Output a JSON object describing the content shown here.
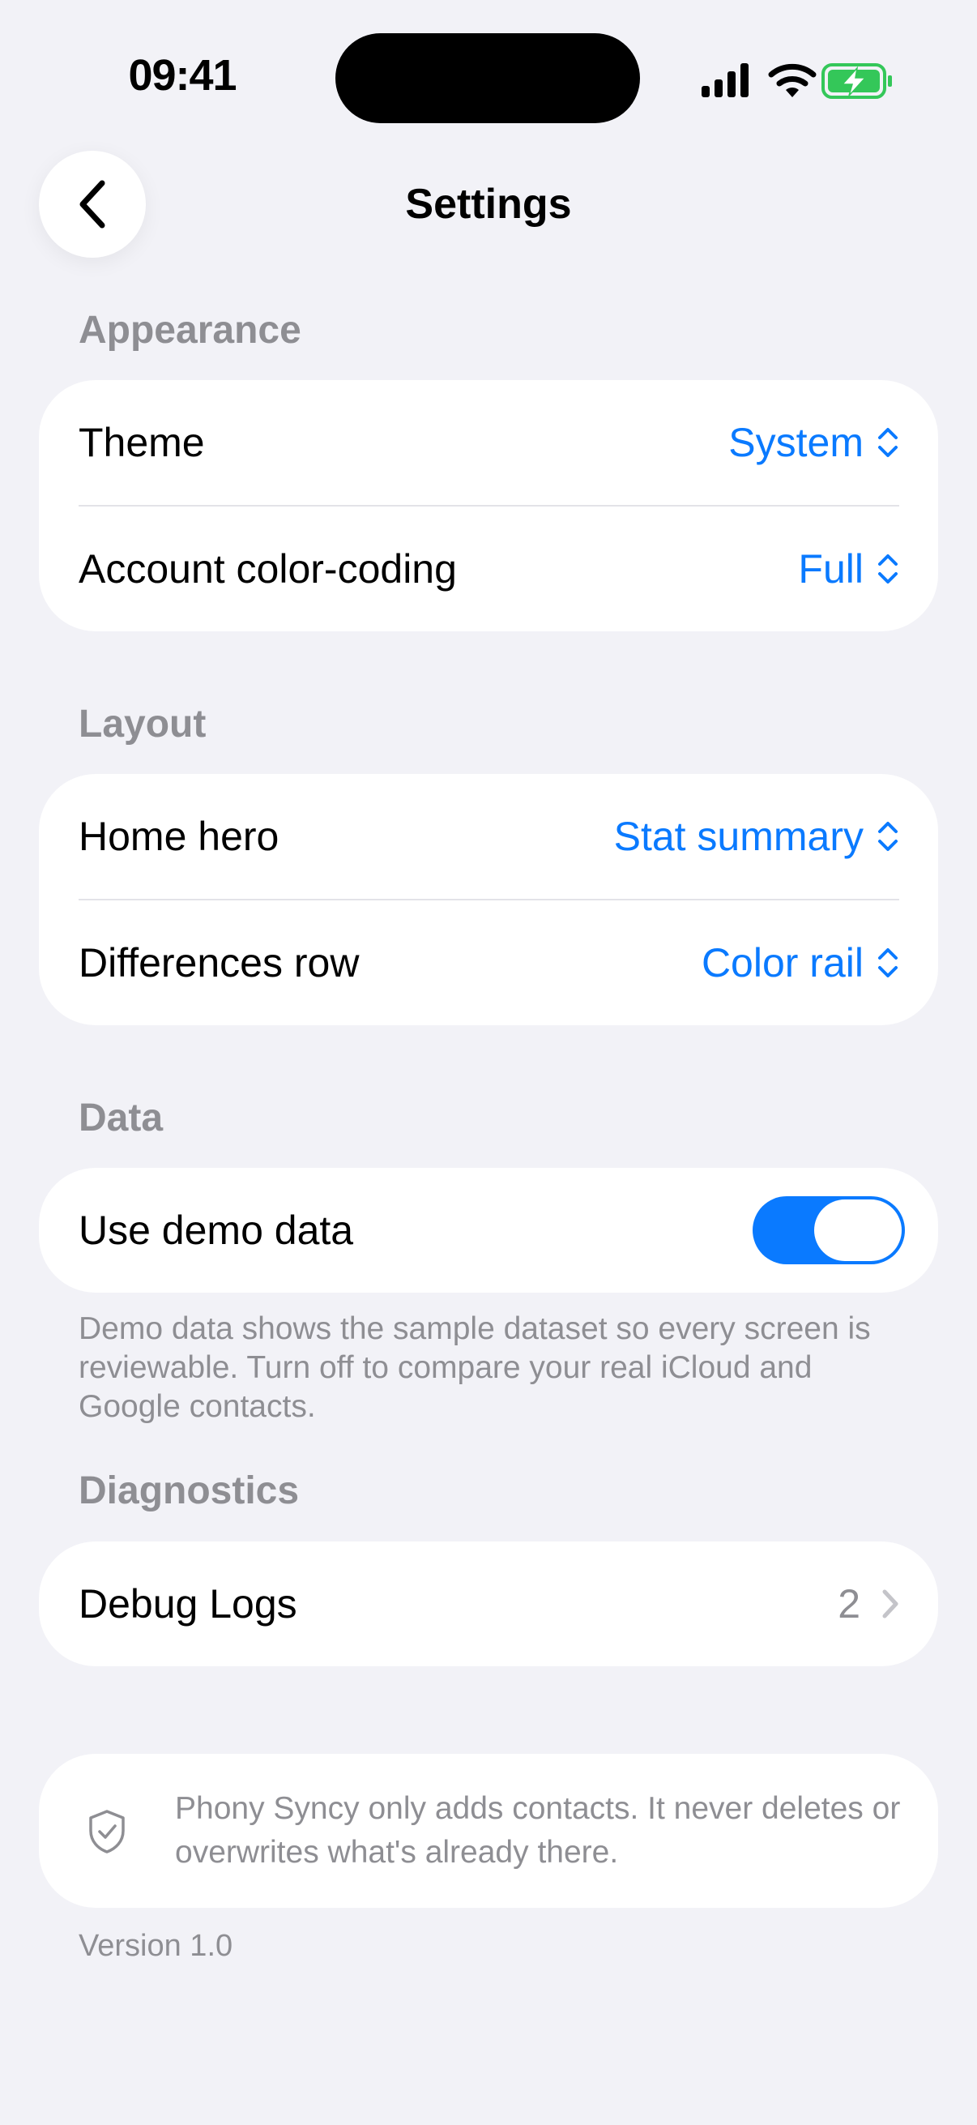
{
  "status_bar": {
    "time": "09:41",
    "icons": [
      "signal-icon",
      "wifi-icon",
      "battery-charging-icon"
    ],
    "battery_color": "#34C759"
  },
  "nav": {
    "title": "Settings",
    "back_icon": "chevron-left-icon"
  },
  "colors": {
    "accent": "#0A7AFF",
    "secondary_text": "#8E8E93",
    "background": "#F2F2F7",
    "card": "#FFFFFF"
  },
  "appearance": {
    "header": "Appearance",
    "theme": {
      "label": "Theme",
      "value": "System"
    },
    "color_coding": {
      "label": "Account color-coding",
      "value": "Full"
    }
  },
  "layout": {
    "header": "Layout",
    "home_hero": {
      "label": "Home hero",
      "value": "Stat summary"
    },
    "differences_row": {
      "label": "Differences row",
      "value": "Color rail"
    }
  },
  "data": {
    "header": "Data",
    "use_demo_data": {
      "label": "Use demo data",
      "on": true
    },
    "footnote": "Demo data shows the sample dataset so every screen is reviewable. Turn off to compare your real iCloud and Google contacts."
  },
  "diagnostics": {
    "header": "Diagnostics",
    "debug_logs": {
      "label": "Debug Logs",
      "count": "2"
    }
  },
  "info": {
    "icon": "shield-check-icon",
    "text": "Phony Syncy only adds contacts. It never deletes or overwrites what's already there."
  },
  "version": "Version 1.0"
}
